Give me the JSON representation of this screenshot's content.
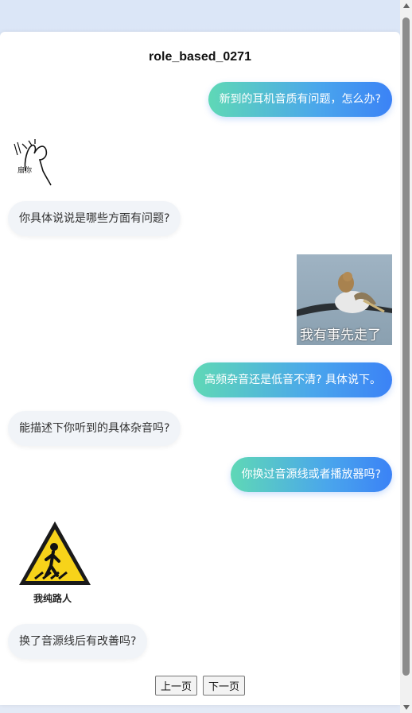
{
  "title": "role_based_0271",
  "messages": [
    {
      "role": "user",
      "text": "新到的耳机音质有问题，怎么办?"
    },
    {
      "role": "bot-sticker",
      "caption": "扇你",
      "sticker": "hand-waving-sticker"
    },
    {
      "role": "bot",
      "text": "你具体说说是哪些方面有问题?"
    },
    {
      "role": "user-sticker",
      "caption": "我有事先走了",
      "sticker": "pelican-bird-sticker"
    },
    {
      "role": "user",
      "text": "高频杂音还是低音不清? 具体说下。"
    },
    {
      "role": "bot",
      "text": "能描述下你听到的具体杂音吗?"
    },
    {
      "role": "user",
      "text": "你换过音源线或者播放器吗?"
    },
    {
      "role": "bot-sticker",
      "caption": "我纯路人",
      "sticker": "pedestrian-warning-sticker"
    },
    {
      "role": "bot",
      "text": "换了音源线后有改善吗?"
    }
  ],
  "pager": {
    "prev": "上一页",
    "next": "下一页"
  },
  "colors": {
    "user_start": "#5fd8b6",
    "user_end": "#3b82f6",
    "bot_bg": "#f1f4f8"
  }
}
